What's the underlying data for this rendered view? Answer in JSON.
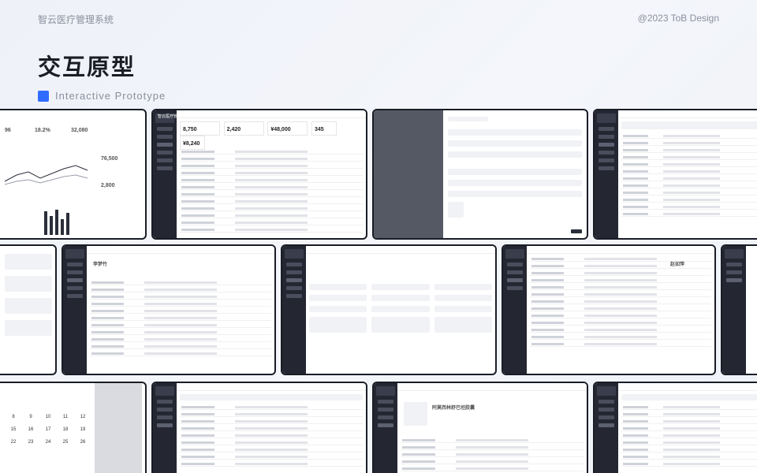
{
  "header": {
    "system_name": "智云医疗管理系统",
    "copyright": "@2023 ToB Design"
  },
  "hero": {
    "title": "交互原型",
    "subtitle": "Interactive Prototype"
  },
  "thumbnails": {
    "dashboard": {
      "stat1": "96",
      "stat2": "18.2%",
      "stat3": "32,080",
      "stat4": "76,500",
      "stat5": "2,800"
    },
    "list": {
      "brand": "智云医疗管理",
      "stat1": "8,750",
      "stat2": "2,420",
      "stat3": "¥48,000",
      "stat4": "345",
      "stat5": "¥8,240"
    },
    "patient": {
      "name": "李梦竹"
    },
    "detail": {
      "name": "赵如萍"
    },
    "order": {
      "title": "阿莫西林舒巴坦胶囊"
    },
    "calendar": {
      "days": [
        "8",
        "9",
        "10",
        "11",
        "12",
        "15",
        "16",
        "17",
        "18",
        "19",
        "22",
        "23",
        "24",
        "25",
        "26"
      ]
    }
  }
}
